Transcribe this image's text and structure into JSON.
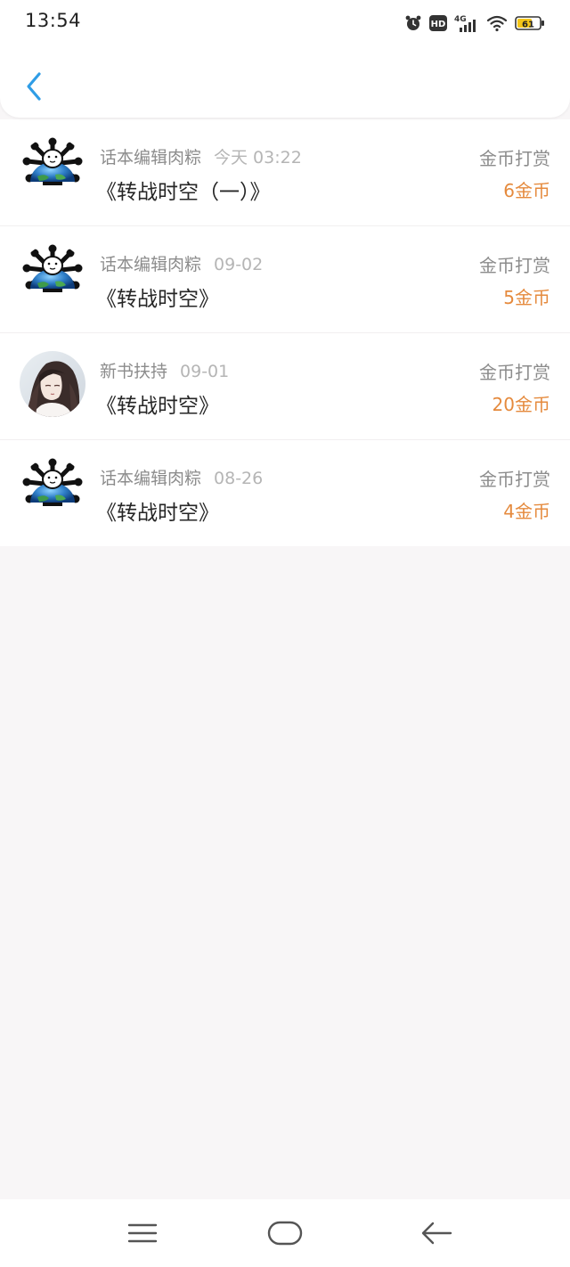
{
  "status_bar": {
    "time": "13:54",
    "network": "4G",
    "hd_label": "HD",
    "battery": "61",
    "icons": [
      "alarm-icon",
      "hd-icon",
      "signal-4g-icon",
      "wifi-icon",
      "battery-icon"
    ]
  },
  "header": {
    "back_icon": "chevron-left-icon",
    "accent_color": "#2f9de6"
  },
  "colors": {
    "amount": "#e58a3d",
    "meta": "#8c8c8c",
    "date": "#b5b5b5",
    "title": "#262626"
  },
  "records": [
    {
      "sender": "话本编辑肉粽",
      "date": "今天 03:22",
      "title": "《转战时空（一）》",
      "type": "金币打赏",
      "amount": "6金币",
      "avatar": "globe-logo-avatar"
    },
    {
      "sender": "话本编辑肉粽",
      "date": "09-02",
      "title": "《转战时空》",
      "type": "金币打赏",
      "amount": "5金币",
      "avatar": "globe-logo-avatar"
    },
    {
      "sender": "新书扶持",
      "date": "09-01",
      "title": "《转战时空》",
      "type": "金币打赏",
      "amount": "20金币",
      "avatar": "character-portrait-avatar"
    },
    {
      "sender": "话本编辑肉粽",
      "date": "08-26",
      "title": "《转战时空》",
      "type": "金币打赏",
      "amount": "4金币",
      "avatar": "globe-logo-avatar"
    }
  ],
  "nav_bar": {
    "icons": [
      "menu-icon",
      "home-icon",
      "back-arrow-icon"
    ]
  }
}
